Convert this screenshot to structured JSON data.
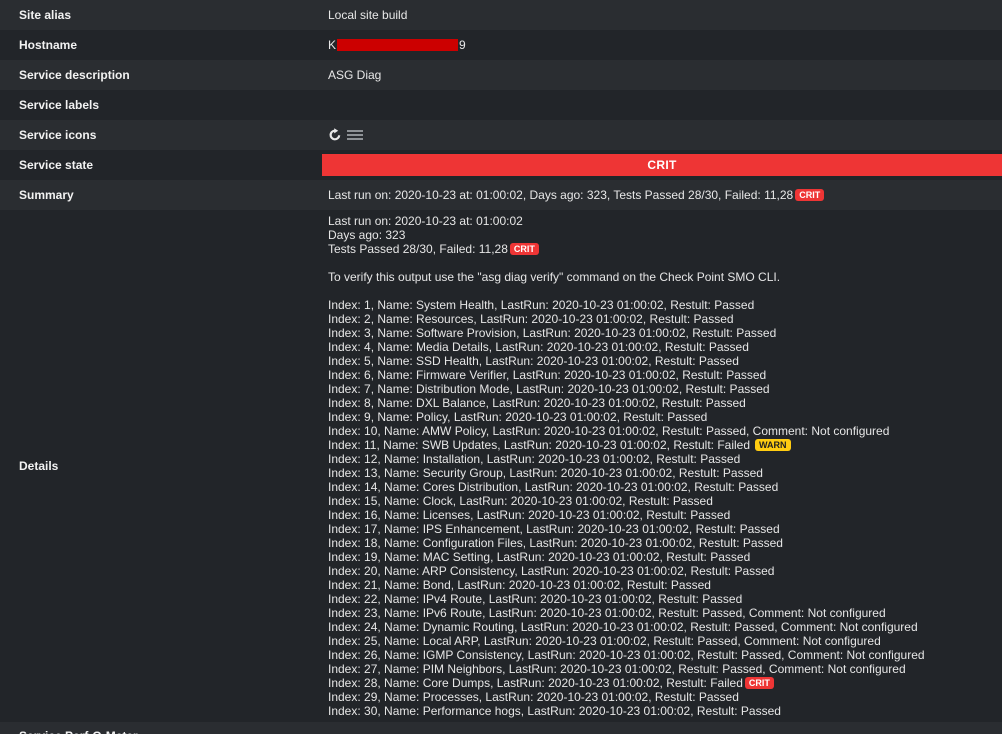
{
  "rows": {
    "site_alias": {
      "label": "Site alias",
      "value": "Local site build"
    },
    "hostname": {
      "label": "Hostname",
      "value_prefix": "K",
      "value_suffix": "9"
    },
    "service_description": {
      "label": "Service description",
      "value": "ASG Diag"
    },
    "service_labels": {
      "label": "Service labels",
      "value": ""
    },
    "service_icons": {
      "label": "Service icons",
      "icons": [
        "reload-icon",
        "menu-icon"
      ]
    },
    "service_state": {
      "label": "Service state",
      "value": "CRIT",
      "color": "#ee3535"
    },
    "summary": {
      "label": "Summary",
      "value": "Last run on: 2020-10-23 at: 01:00:02, Days ago: 323, Tests Passed 28/30, Failed: 11,28",
      "badge": "CRIT"
    }
  },
  "details": {
    "label": "Details",
    "last_run": "Last run on: 2020-10-23 at: 01:00:02",
    "days_ago": "Days ago: 323",
    "tests": "Tests Passed 28/30, Failed: 11,28",
    "tests_badge": "CRIT",
    "verify_note": "To verify this output use the \"asg diag verify\" command on the Check Point SMO CLI.",
    "lines": [
      {
        "text": "Index: 1, Name: System Health, LastRun: 2020-10-23 01:00:02, Restult: Passed",
        "badge": null
      },
      {
        "text": "Index: 2, Name: Resources, LastRun: 2020-10-23 01:00:02, Restult: Passed",
        "badge": null
      },
      {
        "text": "Index: 3, Name: Software Provision, LastRun: 2020-10-23 01:00:02, Restult: Passed",
        "badge": null
      },
      {
        "text": "Index: 4, Name: Media Details, LastRun: 2020-10-23 01:00:02, Restult: Passed",
        "badge": null
      },
      {
        "text": "Index: 5, Name: SSD Health, LastRun: 2020-10-23 01:00:02, Restult: Passed",
        "badge": null
      },
      {
        "text": "Index: 6, Name: Firmware Verifier, LastRun: 2020-10-23 01:00:02, Restult: Passed",
        "badge": null
      },
      {
        "text": "Index: 7, Name: Distribution Mode, LastRun: 2020-10-23 01:00:02, Restult: Passed",
        "badge": null
      },
      {
        "text": "Index: 8, Name: DXL Balance, LastRun: 2020-10-23 01:00:02, Restult: Passed",
        "badge": null
      },
      {
        "text": "Index: 9, Name: Policy, LastRun: 2020-10-23 01:00:02, Restult: Passed",
        "badge": null
      },
      {
        "text": "Index: 10, Name: AMW Policy, LastRun: 2020-10-23 01:00:02, Restult: Passed, Comment: Not configured",
        "badge": null
      },
      {
        "text": "Index: 11, Name: SWB Updates, LastRun: 2020-10-23 01:00:02, Restult: Failed",
        "badge": "WARN"
      },
      {
        "text": "Index: 12, Name: Installation, LastRun: 2020-10-23 01:00:02, Restult: Passed",
        "badge": null
      },
      {
        "text": "Index: 13, Name: Security Group, LastRun: 2020-10-23 01:00:02, Restult: Passed",
        "badge": null
      },
      {
        "text": "Index: 14, Name: Cores Distribution, LastRun: 2020-10-23 01:00:02, Restult: Passed",
        "badge": null
      },
      {
        "text": "Index: 15, Name: Clock, LastRun: 2020-10-23 01:00:02, Restult: Passed",
        "badge": null
      },
      {
        "text": "Index: 16, Name: Licenses, LastRun: 2020-10-23 01:00:02, Restult: Passed",
        "badge": null
      },
      {
        "text": "Index: 17, Name: IPS Enhancement, LastRun: 2020-10-23 01:00:02, Restult: Passed",
        "badge": null
      },
      {
        "text": "Index: 18, Name: Configuration Files, LastRun: 2020-10-23 01:00:02, Restult: Passed",
        "badge": null
      },
      {
        "text": "Index: 19, Name: MAC Setting, LastRun: 2020-10-23 01:00:02, Restult: Passed",
        "badge": null
      },
      {
        "text": "Index: 20, Name: ARP Consistency, LastRun: 2020-10-23 01:00:02, Restult: Passed",
        "badge": null
      },
      {
        "text": "Index: 21, Name: Bond, LastRun: 2020-10-23 01:00:02, Restult: Passed",
        "badge": null
      },
      {
        "text": "Index: 22, Name: IPv4 Route, LastRun: 2020-10-23 01:00:02, Restult: Passed",
        "badge": null
      },
      {
        "text": "Index: 23, Name: IPv6 Route, LastRun: 2020-10-23 01:00:02, Restult: Passed, Comment: Not configured",
        "badge": null
      },
      {
        "text": "Index: 24, Name: Dynamic Routing, LastRun: 2020-10-23 01:00:02, Restult: Passed, Comment: Not configured",
        "badge": null
      },
      {
        "text": "Index: 25, Name: Local ARP, LastRun: 2020-10-23 01:00:02, Restult: Passed, Comment: Not configured",
        "badge": null
      },
      {
        "text": "Index: 26, Name: IGMP Consistency, LastRun: 2020-10-23 01:00:02, Restult: Passed, Comment: Not configured",
        "badge": null
      },
      {
        "text": "Index: 27, Name: PIM Neighbors, LastRun: 2020-10-23 01:00:02, Restult: Passed, Comment: Not configured",
        "badge": null
      },
      {
        "text": "Index: 28, Name: Core Dumps, LastRun: 2020-10-23 01:00:02, Restult: Failed",
        "badge": "CRIT"
      },
      {
        "text": "Index: 29, Name: Processes, LastRun: 2020-10-23 01:00:02, Restult: Passed",
        "badge": null
      },
      {
        "text": "Index: 30, Name: Performance hogs, LastRun: 2020-10-23 01:00:02, Restult: Passed",
        "badge": null
      }
    ]
  },
  "next_row_label": "Service Perf-O-Meter"
}
